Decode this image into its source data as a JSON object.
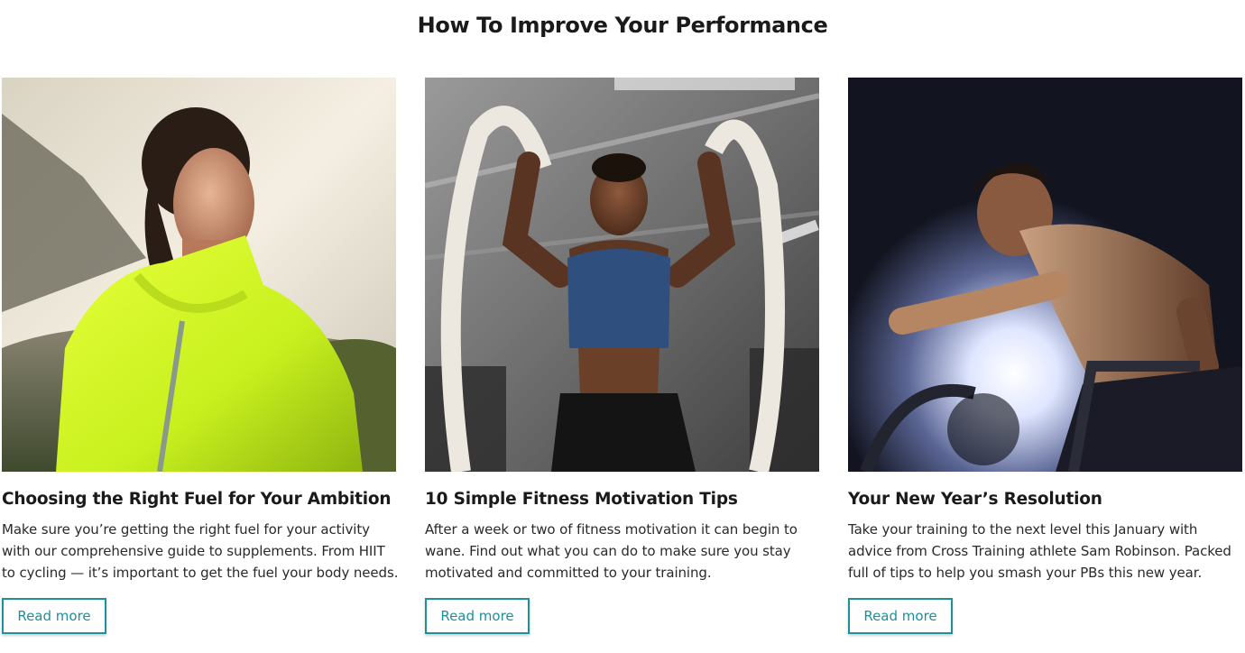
{
  "section": {
    "title": "How To Improve Your Performance"
  },
  "cards": [
    {
      "title": "Choosing the Right Fuel for Your Ambition",
      "text": "Make sure you’re getting the right fuel for your activity with our comprehensive guide to supplements. From HIIT to cycling — it’s important to get the fuel your body needs.",
      "button": "Read more",
      "image_icon": "runner-yellow-jacket-photo"
    },
    {
      "title": "10 Simple Fitness Motivation Tips",
      "text": "After a week or two of fitness motivation it can begin to wane. Find out what you can do to make sure you stay motivated and committed to your training.",
      "button": "Read more",
      "image_icon": "battle-ropes-gym-photo"
    },
    {
      "title": "Your New Year’s Resolution",
      "text": "Take your training to the next level this January with advice from Cross Training athlete Sam Robinson. Packed full of tips to help you smash your PBs this new year.",
      "button": "Read more",
      "image_icon": "air-bike-athlete-photo"
    }
  ],
  "colors": {
    "accent": "#1f8f9a",
    "text": "#1a1a1a",
    "background": "#ffffff"
  }
}
